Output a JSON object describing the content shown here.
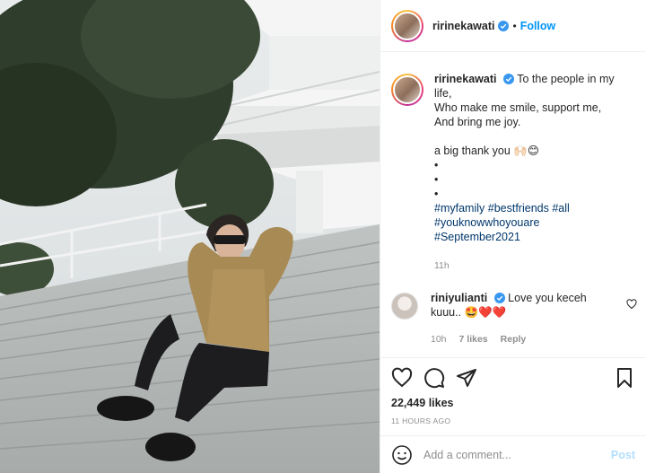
{
  "header": {
    "username": "ririnekawati",
    "separator": "•",
    "follow_label": "Follow"
  },
  "caption": {
    "username": "ririnekawati",
    "lines": [
      "To the people in my",
      "life,",
      "Who make me smile, support me,",
      "And bring me joy.",
      "",
      "a big thank you 🙌🏻😊",
      "•",
      "•",
      "•"
    ],
    "hashtags_line1": [
      "#myfamily",
      "#bestfriends",
      "#all"
    ],
    "hashtags_line2": "#youknowwhoyouare",
    "hashtags_line3": "#September2021",
    "time": "11h"
  },
  "comment": {
    "username": "riniyulianti",
    "text": "Love you keceh",
    "text2": "kuuu.. 🤩❤️❤️",
    "time": "10h",
    "likes": "7 likes",
    "reply": "Reply"
  },
  "actions": {
    "likes": "22,449 likes",
    "timestamp": "11 HOURS AGO",
    "icons": [
      "heart-icon",
      "comment-icon",
      "share-icon",
      "bookmark-icon"
    ]
  },
  "add_comment": {
    "placeholder": "Add a comment...",
    "post_label": "Post"
  },
  "colors": {
    "link_blue": "#0095f6",
    "hashtag": "#00376b",
    "muted": "#8e8e8e",
    "post_disabled": "#b2dffc"
  }
}
